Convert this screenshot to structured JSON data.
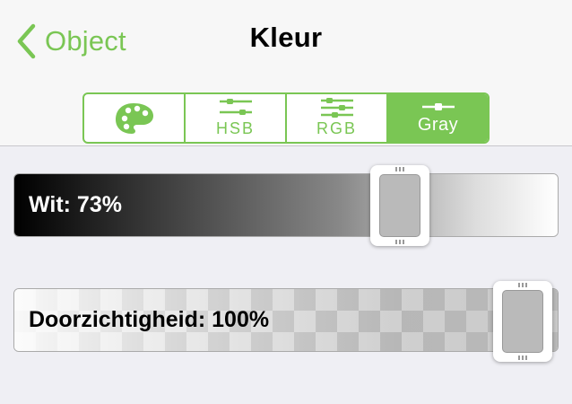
{
  "nav": {
    "back_label": "Object",
    "title": "Kleur"
  },
  "segments": [
    {
      "label": "",
      "icon": "palette-icon",
      "selected": false
    },
    {
      "label": "HSB",
      "icon": "sliders-icon",
      "selected": false
    },
    {
      "label": "RGB",
      "icon": "sliders-icon",
      "selected": false
    },
    {
      "label": "Gray",
      "icon": "slider-icon",
      "selected": true
    }
  ],
  "sliders": {
    "white": {
      "label": "Wit: 73%",
      "value": 0.73
    },
    "opacity": {
      "label": "Doorzichtigheid: 100%",
      "value": 1.0
    }
  },
  "colors": {
    "accent": "#7ac654",
    "thumb_fill_white": "#bababa",
    "thumb_fill_opacity": "#bababa"
  }
}
